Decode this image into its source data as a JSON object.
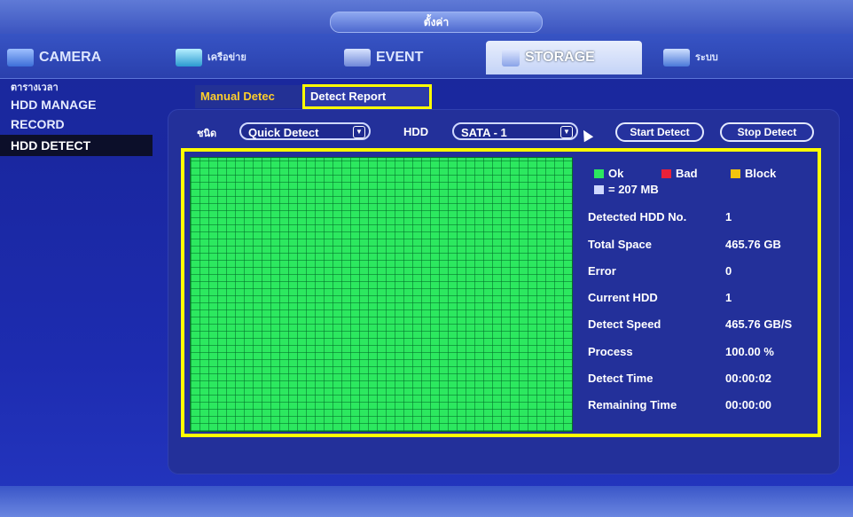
{
  "window": {
    "title": "ตั้งค่า"
  },
  "main_tabs": [
    {
      "label": "CAMERA",
      "icon": "camera-icon",
      "active": false
    },
    {
      "label": "เครือข่าย",
      "icon": "network-icon",
      "active": false
    },
    {
      "label": "EVENT",
      "icon": "event-icon",
      "active": false
    },
    {
      "label": "STORAGE",
      "icon": "storage-icon",
      "active": true
    },
    {
      "label": "ระบบ",
      "icon": "system-icon",
      "active": false
    }
  ],
  "sidebar": {
    "items": [
      {
        "label": "ตารางเวลา",
        "active": false
      },
      {
        "label": "HDD MANAGE",
        "active": false
      },
      {
        "label": "RECORD",
        "active": false
      },
      {
        "label": "HDD DETECT",
        "active": true
      }
    ]
  },
  "subtabs": {
    "manual": "Manual Detec",
    "report": "Detect Report"
  },
  "toolbar": {
    "type_label": "ชนิด",
    "type_value": "Quick Detect",
    "hdd_label": "HDD",
    "hdd_value": "SATA - 1",
    "start_button": "Start Detect",
    "stop_button": "Stop Detect"
  },
  "legend": {
    "ok": "Ok",
    "bad": "Bad",
    "block": "Block",
    "unit": "= 207 MB",
    "colors": {
      "ok": "#2ce85f",
      "bad": "#e8213a",
      "block": "#f1c40f",
      "unit": "#cfd8ff"
    }
  },
  "info": [
    {
      "label": "Detected HDD No.",
      "value": "1"
    },
    {
      "label": "Total Space",
      "value": "465.76 GB"
    },
    {
      "label": "Error",
      "value": "0"
    },
    {
      "label": "Current HDD",
      "value": "1"
    },
    {
      "label": "Detect Speed",
      "value": "465.76 GB/S"
    },
    {
      "label": "Process",
      "value": "100.00 %"
    },
    {
      "label": "Detect Time",
      "value": "00:00:02"
    },
    {
      "label": "Remaining Time",
      "value": "00:00:00"
    }
  ]
}
